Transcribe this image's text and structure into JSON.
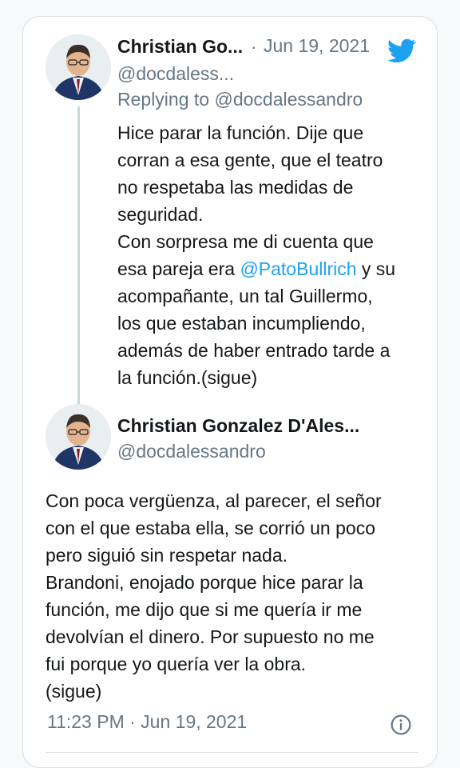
{
  "tweet1": {
    "author_name": "Christian Go...",
    "separator": "·",
    "date": "Jun 19, 2021",
    "handle": "@docdaless...",
    "replying_prefix": "Replying to",
    "replying_handle": "@docdalessandro",
    "text_lines": [
      "Hice parar la función. Dije que",
      "corran a esa gente, que el teatro",
      "no respetaba las medidas de",
      "seguridad.",
      "Con sorpresa me di cuenta que"
    ],
    "line6_before": "esa pareja era ",
    "line6_mention": "@PatoBullrich",
    "line6_after": " y su",
    "text_lines_end": [
      "acompañante, un tal Guillermo,",
      "los que estaban incumpliendo,",
      "además de haber entrado tarde a",
      "la función.(sigue)"
    ]
  },
  "tweet2": {
    "author_name": "Christian Gonzalez D'Ales...",
    "handle": "@docdalessandro",
    "text_lines": [
      "Con poca vergüenza, al parecer, el señor",
      "con el que estaba ella, se corrió un poco",
      "pero siguió sin respetar nada.",
      "Brandoni, enojado porque hice parar la",
      "función, me dijo que si me quería ir me",
      "devolvían el dinero. Por supuesto no me",
      "fui porque yo quería ver la obra.",
      "(sigue)"
    ],
    "timestamp": "11:23 PM · Jun 19, 2021"
  },
  "icons": {
    "brand": "twitter-bird-icon",
    "info": "info-icon"
  },
  "colors": {
    "twitter_blue": "#1da1f2",
    "text_primary": "#14171a",
    "text_secondary": "#657786"
  }
}
